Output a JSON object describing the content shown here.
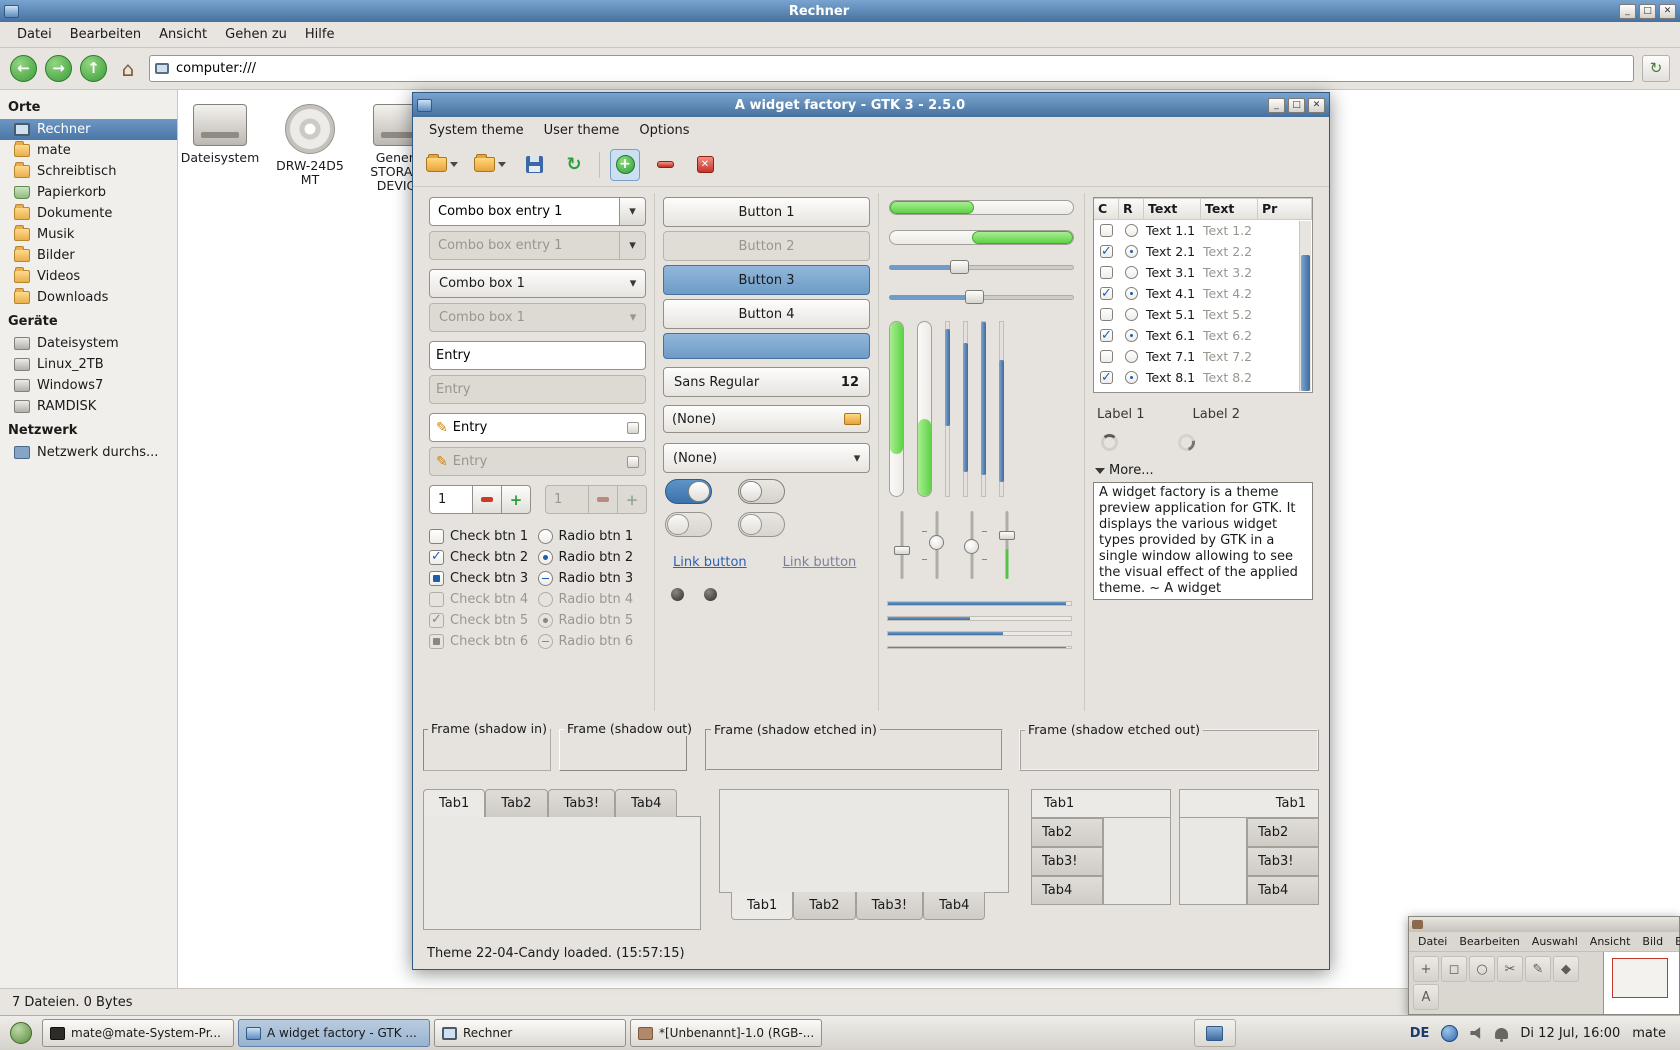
{
  "caja": {
    "title": "Rechner",
    "menus": [
      "Datei",
      "Bearbeiten",
      "Ansicht",
      "Gehen zu",
      "Hilfe"
    ],
    "location": "computer:///",
    "sidebar": {
      "sections": [
        {
          "title": "Orte",
          "items": [
            {
              "label": "Rechner",
              "icon": "computer",
              "selected": true
            },
            {
              "label": "mate",
              "icon": "folder-home",
              "selected": false
            },
            {
              "label": "Schreibtisch",
              "icon": "folder-desktop",
              "selected": false
            },
            {
              "label": "Papierkorb",
              "icon": "trash",
              "selected": false
            },
            {
              "label": "Dokumente",
              "icon": "folder",
              "selected": false
            },
            {
              "label": "Musik",
              "icon": "folder",
              "selected": false
            },
            {
              "label": "Bilder",
              "icon": "folder",
              "selected": false
            },
            {
              "label": "Videos",
              "icon": "folder",
              "selected": false
            },
            {
              "label": "Downloads",
              "icon": "folder",
              "selected": false
            }
          ]
        },
        {
          "title": "Geräte",
          "items": [
            {
              "label": "Dateisystem",
              "icon": "drive",
              "selected": false
            },
            {
              "label": "Linux_2TB",
              "icon": "drive",
              "selected": false
            },
            {
              "label": "Windows7",
              "icon": "drive",
              "selected": false
            },
            {
              "label": "RAMDISK",
              "icon": "drive",
              "selected": false
            }
          ]
        },
        {
          "title": "Netzwerk",
          "items": [
            {
              "label": "Netzwerk durchs...",
              "icon": "network",
              "selected": false
            }
          ]
        }
      ]
    },
    "files": [
      {
        "label": "Dateisystem",
        "icon": "drive"
      },
      {
        "label": "DRW-24D5 MT",
        "icon": "optical-disc"
      },
      {
        "label": "Generic STORAGE DEVICE",
        "icon": "drive"
      }
    ],
    "statusbar": "7 Dateien. 0 Bytes"
  },
  "wf": {
    "title": "A widget factory - GTK 3 - 2.5.0",
    "menus": [
      "System theme",
      "User theme",
      "Options"
    ],
    "combos": {
      "combo_entry_1": "Combo box entry 1",
      "combo_entry_2": "Combo box entry 1",
      "combo_1": "Combo box 1",
      "combo_2": "Combo box 1"
    },
    "entries": {
      "entry1": "Entry",
      "entry2": "Entry",
      "entry3": "Entry",
      "entry4": "Entry"
    },
    "spins": {
      "spin1": "1",
      "spin2": "1"
    },
    "checks": [
      {
        "label": "Check btn 1",
        "state": "unchecked",
        "enabled": true
      },
      {
        "label": "Check btn 2",
        "state": "checked",
        "enabled": true
      },
      {
        "label": "Check btn 3",
        "state": "mixed",
        "enabled": true
      },
      {
        "label": "Check btn 4",
        "state": "unchecked",
        "enabled": false
      },
      {
        "label": "Check btn 5",
        "state": "checked",
        "enabled": false
      },
      {
        "label": "Check btn 6",
        "state": "mixed",
        "enabled": false
      }
    ],
    "radios": [
      {
        "label": "Radio btn 1",
        "state": "off",
        "enabled": true
      },
      {
        "label": "Radio btn 2",
        "state": "on",
        "enabled": true
      },
      {
        "label": "Radio btn 3",
        "state": "mixed",
        "enabled": true
      },
      {
        "label": "Radio btn 4",
        "state": "off",
        "enabled": false
      },
      {
        "label": "Radio btn 5",
        "state": "on",
        "enabled": false
      },
      {
        "label": "Radio btn 6",
        "state": "mixed",
        "enabled": false
      }
    ],
    "buttons": [
      "Button 1",
      "Button 2",
      "Button 3",
      "Button 4"
    ],
    "font_button": {
      "name": "Sans Regular",
      "size": "12"
    },
    "file_chooser": "(None)",
    "combo_none": "(None)",
    "links": [
      "Link button",
      "Link button"
    ],
    "tree": {
      "headers": [
        "C",
        "R",
        "Text",
        "Text",
        "Pr"
      ],
      "rows": [
        {
          "checked": false,
          "radio": false,
          "t1": "Text 1.1",
          "t2": "Text 1.2"
        },
        {
          "checked": true,
          "radio": true,
          "t1": "Text 2.1",
          "t2": "Text 2.2"
        },
        {
          "checked": false,
          "radio": false,
          "t1": "Text 3.1",
          "t2": "Text 3.2"
        },
        {
          "checked": true,
          "radio": true,
          "t1": "Text 4.1",
          "t2": "Text 4.2"
        },
        {
          "checked": false,
          "radio": false,
          "t1": "Text 5.1",
          "t2": "Text 5.2"
        },
        {
          "checked": true,
          "radio": true,
          "t1": "Text 6.1",
          "t2": "Text 6.2"
        },
        {
          "checked": false,
          "radio": false,
          "t1": "Text 7.1",
          "t2": "Text 7.2"
        },
        {
          "checked": true,
          "radio": true,
          "t1": "Text 8.1",
          "t2": "Text 8.2"
        }
      ]
    },
    "labels": [
      "Label 1",
      "Label 2"
    ],
    "expander": "More...",
    "about_text": "A widget factory is a theme preview application for GTK. It displays the various widget types provided by GTK in a single window allowing to see the visual effect of the applied theme. ~ A widget",
    "frames": [
      "Frame (shadow in)",
      "Frame (shadow out)",
      "Frame (shadow etched in)",
      "Frame (shadow etched out)"
    ],
    "tabs": [
      "Tab1",
      "Tab2",
      "Tab3!",
      "Tab4"
    ],
    "statusbar": "Theme 22-04-Candy loaded.  (15:57:15)",
    "progress": {
      "bar1_percent": 46,
      "bar2_percent": 55,
      "hscale1_percent": 38,
      "hscale2_percent": 46
    }
  },
  "gimp": {
    "menus": [
      "Datei",
      "Bearbeiten",
      "Auswahl",
      "Ansicht",
      "Bild",
      "Ebe"
    ]
  },
  "taskbar": {
    "tasks": [
      {
        "label": "mate@mate-System-Pr...",
        "active": false,
        "icon": "terminal"
      },
      {
        "label": "A widget factory - GTK ...",
        "active": true,
        "icon": "widget-factory"
      },
      {
        "label": "Rechner",
        "active": false,
        "icon": "file-manager"
      },
      {
        "label": "*[Unbenannt]-1.0 (RGB-...",
        "active": false,
        "icon": "gimp"
      }
    ],
    "keyboard_layout": "DE",
    "clock": "Di 12 Jul, 16:00",
    "user": "mate"
  },
  "colors": {
    "titlebar_blue": "#46719e",
    "selection_blue": "#4a77a8",
    "progress_green": "#5ed246",
    "scrollbar_blue": "#4a7cb0"
  }
}
